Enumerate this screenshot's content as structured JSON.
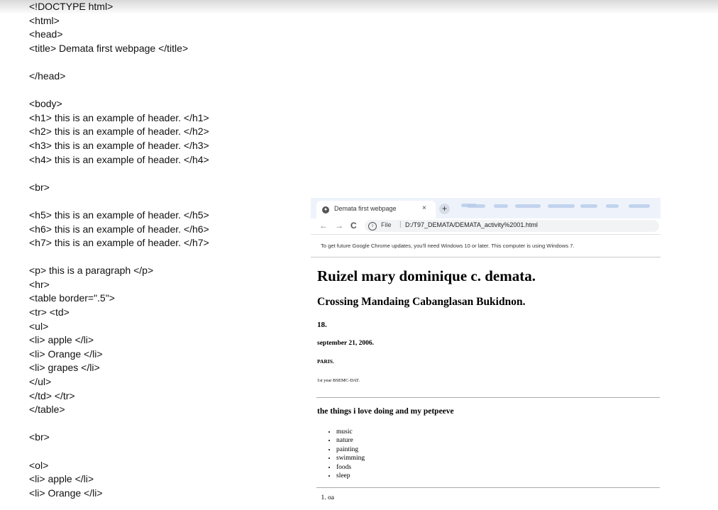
{
  "code_lines": [
    "<!DOCTYPE html>",
    "<html>",
    "<head>",
    "<title> Demata first webpage </title>",
    "",
    "</head>",
    "",
    "<body>",
    "<h1> this is an example of header. </h1>",
    "<h2> this is an example of header. </h2>",
    "<h3> this is an example of header. </h3>",
    "<h4> this is an example of header. </h4>",
    "",
    "<br>",
    "",
    "<h5> this is an example of header. </h5>",
    "<h6> this is an example of header. </h6>",
    "<h7> this is an example of header. </h7>",
    "",
    "<p> this is a paragraph </p>",
    "<hr>",
    "<table border=\".5\">",
    "<tr> <td>",
    "<ul>",
    "<li> apple </li>",
    "<li> Orange </li>",
    "<li> grapes </li>",
    "</ul>",
    "</td> </tr>",
    "</table>",
    "",
    "<br>",
    "",
    "<ol>",
    "<li> apple </li>",
    "<li> Orange </li>"
  ],
  "browser": {
    "tab_title": "Demata first webpage",
    "tab_close": "×",
    "new_tab": "+",
    "nav_back": "←",
    "nav_forward": "→",
    "nav_reload": "C",
    "info_icon": "i",
    "file_label": "File",
    "separator": "|",
    "url": "D:/T97_DEMATA/DEMATA_activity%2001.html",
    "infobar_text": "To get future Google Chrome updates, you'll need Windows 10 or later. This computer is using Windows 7.",
    "icons": [
      "globe-icon",
      "close-icon",
      "plus-icon",
      "back-arrow-icon",
      "forward-arrow-icon",
      "reload-icon",
      "info-icon"
    ]
  },
  "page": {
    "h1": "Ruizel mary dominique c. demata.",
    "h2": "Crossing Mandaing Cabanglasan Bukidnon.",
    "h3": "18.",
    "h4": "september 21, 2006.",
    "h5": "PARIS.",
    "h6": "1st year BSEMC-DAT.",
    "section_heading": "the things i love doing and my petpeeve",
    "list_items": [
      "music",
      "nature",
      "painting",
      "swimming",
      "foods",
      "sleep"
    ],
    "ordered_first": "oa"
  }
}
